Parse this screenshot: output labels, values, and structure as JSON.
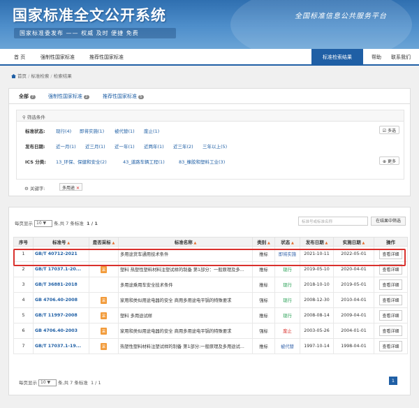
{
  "header": {
    "title": "国家标准全文公开系统",
    "subtitle": "国家标准委发布 —— 权威 及时 便捷 免费",
    "slogan": "全国标准信息公共服务平台"
  },
  "nav": {
    "items": [
      "首 页",
      "强制性国家标准",
      "推荐性国家标准"
    ],
    "active": "标准检索结果",
    "right": [
      "帮助",
      "联系我们"
    ]
  },
  "breadcrumb": {
    "home": "首页",
    "mid": "标准检索",
    "current": "检索结果"
  },
  "tabs": [
    {
      "label": "全部",
      "count": "7"
    },
    {
      "label": "强制性国家标准",
      "count": "2"
    },
    {
      "label": "推荐性国家标准",
      "count": "5"
    }
  ],
  "filter": {
    "title": "筛选条件",
    "status_label": "标准状态:",
    "status_opts": [
      "现行(4)",
      "即将实施(1)",
      "被代替(1)",
      "废止(1)"
    ],
    "multi_label": "多选",
    "date_label": "发布日期:",
    "date_opts": [
      "近一月(1)",
      "近三月(1)",
      "近一年(1)",
      "近两年(1)",
      "近三年(2)",
      "三年以上(5)"
    ],
    "ics_label": "ICS 分类:",
    "ics_opts": [
      "13_环保、保健和安全(2)",
      "43_道路车辆工程(1)",
      "83_橡胶和塑料工业(3)"
    ],
    "more_label": "更多"
  },
  "keyword": {
    "label": "关键字:",
    "tag": "多用途"
  },
  "pager": {
    "prefix": "每页显示",
    "per_page": "10",
    "suffix": "条,共 7 条标准",
    "page_info": "1 / 1",
    "current": "1"
  },
  "search": {
    "placeholder": "标准号或标准名称",
    "button": "在结果中筛选"
  },
  "table": {
    "headers": [
      "序号",
      "标准号",
      "是否采标",
      "标准名称",
      "类别",
      "状态",
      "发布日期",
      "实施日期",
      "操作"
    ],
    "rows": [
      {
        "idx": "1",
        "no": "GB/T 40712-2021",
        "cai": "",
        "name": "多用途货车通用技术条件",
        "type": "推标",
        "status": "即将实施",
        "pub": "2021-10-11",
        "impl": "2022-05-01",
        "op": "查看详细"
      },
      {
        "idx": "2",
        "no": "GB/T 17037.1-20...",
        "cai": "采",
        "name": "塑料 热塑性塑料材料注塑试样的制备 第1部分：一般原理及多...",
        "type": "推标",
        "status": "现行",
        "pub": "2019-05-10",
        "impl": "2020-04-01",
        "op": "查看详细"
      },
      {
        "idx": "3",
        "no": "GB/T 36881-2018",
        "cai": "",
        "name": "多用途乘用车安全技术条件",
        "type": "推标",
        "status": "现行",
        "pub": "2018-10-10",
        "impl": "2019-05-01",
        "op": "查看详细"
      },
      {
        "idx": "4",
        "no": "GB 4706.40-2008",
        "cai": "采",
        "name": "家用和类似用途电器的安全 商用多用途电平锅的特殊要求",
        "type": "强标",
        "status": "现行",
        "pub": "2008-12-30",
        "impl": "2010-04-01",
        "op": "查看详细"
      },
      {
        "idx": "5",
        "no": "GB/T 11997-2008",
        "cai": "采",
        "name": "塑料 多用途试样",
        "type": "推标",
        "status": "现行",
        "pub": "2008-08-14",
        "impl": "2009-04-01",
        "op": "查看详细"
      },
      {
        "idx": "6",
        "no": "GB 4706.40-2003",
        "cai": "采",
        "name": "家用和类似用途电器的安全 商用多用途电平锅的特殊要求",
        "type": "强标",
        "status": "废止",
        "pub": "2003-05-26",
        "impl": "2004-01-01",
        "op": "查看详细"
      },
      {
        "idx": "7",
        "no": "GB/T 17037.1-19...",
        "cai": "采",
        "name": "热塑性塑料材料注塑试样的制备 第1部分:一般原理及多用途试...",
        "type": "推标",
        "status": "被代替",
        "pub": "1997-10-14",
        "impl": "1998-04-01",
        "op": "查看详细"
      }
    ]
  }
}
